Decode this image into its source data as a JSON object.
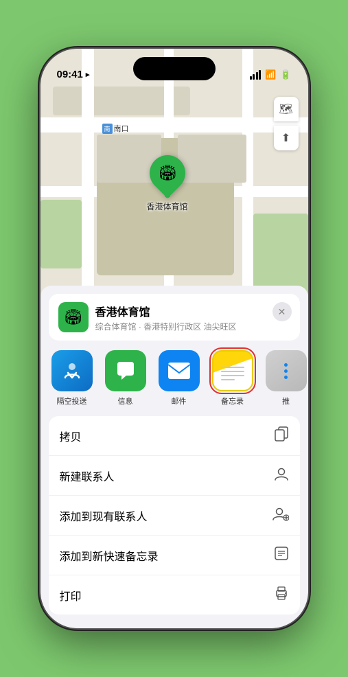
{
  "status": {
    "time": "09:41",
    "location_arrow": "▶",
    "wifi": "wifi",
    "battery": "battery"
  },
  "map": {
    "label_nankou": "南口",
    "label_tag": "南口",
    "pin_label": "香港体育馆",
    "controls": {
      "map_icon": "🗺",
      "location_icon": "◎"
    }
  },
  "location_card": {
    "icon": "🏟",
    "name": "香港体育馆",
    "description": "综合体育馆 · 香港特别行政区 油尖旺区",
    "close_label": "✕"
  },
  "apps": [
    {
      "id": "airdrop",
      "label": "隔空投送",
      "icon_type": "airdrop"
    },
    {
      "id": "messages",
      "label": "信息",
      "icon_type": "messages"
    },
    {
      "id": "mail",
      "label": "邮件",
      "icon_type": "mail"
    },
    {
      "id": "notes",
      "label": "备忘录",
      "icon_type": "notes"
    },
    {
      "id": "more",
      "label": "推",
      "icon_type": "more"
    }
  ],
  "actions": [
    {
      "id": "copy",
      "label": "拷贝",
      "icon": "⎘"
    },
    {
      "id": "new-contact",
      "label": "新建联系人",
      "icon": "👤"
    },
    {
      "id": "add-contact",
      "label": "添加到现有联系人",
      "icon": "👤+"
    },
    {
      "id": "quick-note",
      "label": "添加到新快速备忘录",
      "icon": "📋"
    },
    {
      "id": "print",
      "label": "打印",
      "icon": "🖨"
    }
  ]
}
